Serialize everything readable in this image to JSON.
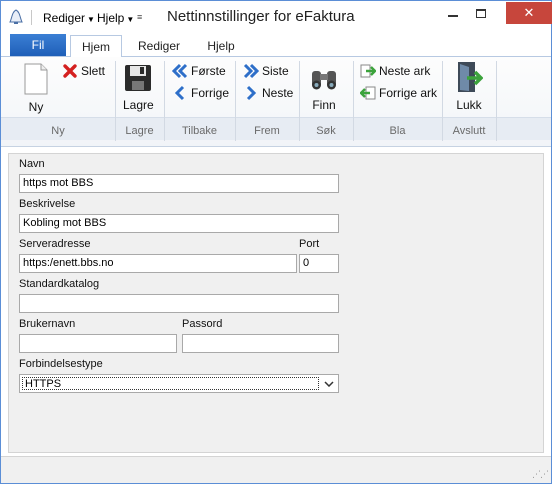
{
  "window": {
    "title": "Nettinnstillinger for eFaktura",
    "quick_access": {
      "menu1": "Rediger",
      "menu2": "Hjelp"
    }
  },
  "tabs": {
    "file": "Fil",
    "items": [
      "Hjem",
      "Rediger",
      "Hjelp"
    ],
    "active": "Hjem"
  },
  "ribbon": {
    "buttons": {
      "new": "Ny",
      "delete": "Slett",
      "save": "Lagre",
      "first": "Første",
      "previous": "Forrige",
      "last": "Siste",
      "next": "Neste",
      "find": "Finn",
      "next_sheet": "Neste ark",
      "previous_sheet": "Forrige ark",
      "close": "Lukk"
    },
    "groups": [
      "Ny",
      "Lagre",
      "Tilbake",
      "Frem",
      "Søk",
      "Bla",
      "Avslutt"
    ]
  },
  "form": {
    "name_label": "Navn",
    "name_value": "https mot BBS",
    "description_label": "Beskrivelse",
    "description_value": "Kobling mot BBS",
    "server_label": "Serveradresse",
    "server_value": "https:/enett.bbs.no",
    "port_label": "Port",
    "port_value": "0",
    "catalog_label": "Standardkatalog",
    "catalog_value": "",
    "username_label": "Brukernavn",
    "username_value": "",
    "password_label": "Passord",
    "password_value": "",
    "conntype_label": "Forbindelsestype",
    "conntype_value": "HTTPS"
  },
  "colors": {
    "file_tab": "#1f5fb8",
    "close_button": "#c7463c",
    "arrow_blue": "#2e6fc9",
    "arrow_green": "#3ca33c",
    "delete_red": "#d42020"
  }
}
